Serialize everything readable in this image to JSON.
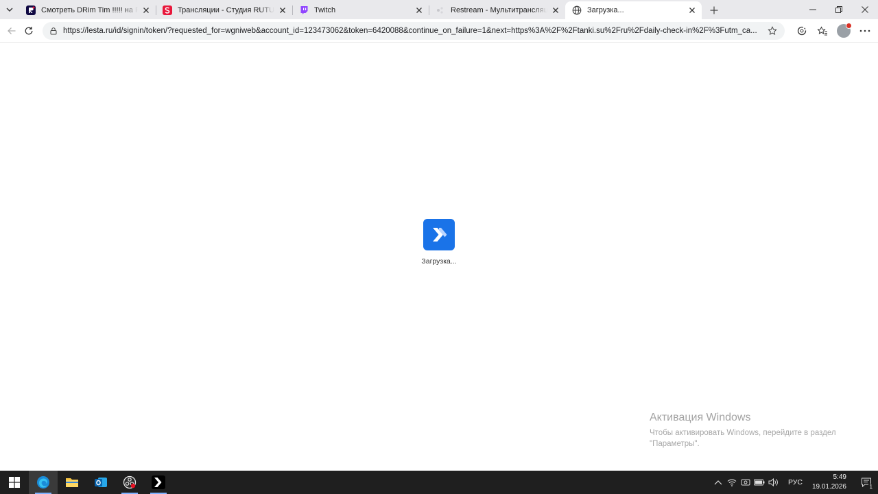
{
  "browser": {
    "tabs": [
      {
        "title": "Смотреть DRim Tim !!!!! на RUTUBE",
        "icon": "rutube-icon",
        "active": false
      },
      {
        "title": "Трансляции - Студия RUTUBE",
        "icon": "rutube-studio-icon",
        "active": false
      },
      {
        "title": "Twitch",
        "icon": "twitch-icon",
        "active": false
      },
      {
        "title": "Restream - Мультитрансляции на",
        "icon": "restream-icon",
        "active": false
      },
      {
        "title": "Загрузка...",
        "icon": "globe-icon",
        "active": true
      }
    ],
    "address": {
      "url": "https://lesta.ru/id/signin/token/?requested_for=wgniweb&account_id=123473062&token=6420088&continue_on_failure=1&next=https%3A%2F%2Ftanki.su%2Fru%2Fdaily-check-in%2F%3Futm_ca..."
    }
  },
  "page": {
    "loading_text": "Загрузка..."
  },
  "watermark": {
    "title": "Активация Windows",
    "line1": "Чтобы активировать Windows, перейдите в раздел",
    "line2": "\"Параметры\"."
  },
  "taskbar": {
    "apps": [
      "windows-start-icon",
      "edge-icon",
      "file-explorer-icon",
      "outlook-icon",
      "obs-icon",
      "lesta-game-center-icon"
    ],
    "language": "РУС",
    "time": "5:49",
    "date": "19.01.2026",
    "notification_count": "1"
  },
  "colors": {
    "accent": "#1a73e8",
    "taskbar": "#1f1f1f",
    "tabstrip": "#e9e9ec"
  }
}
